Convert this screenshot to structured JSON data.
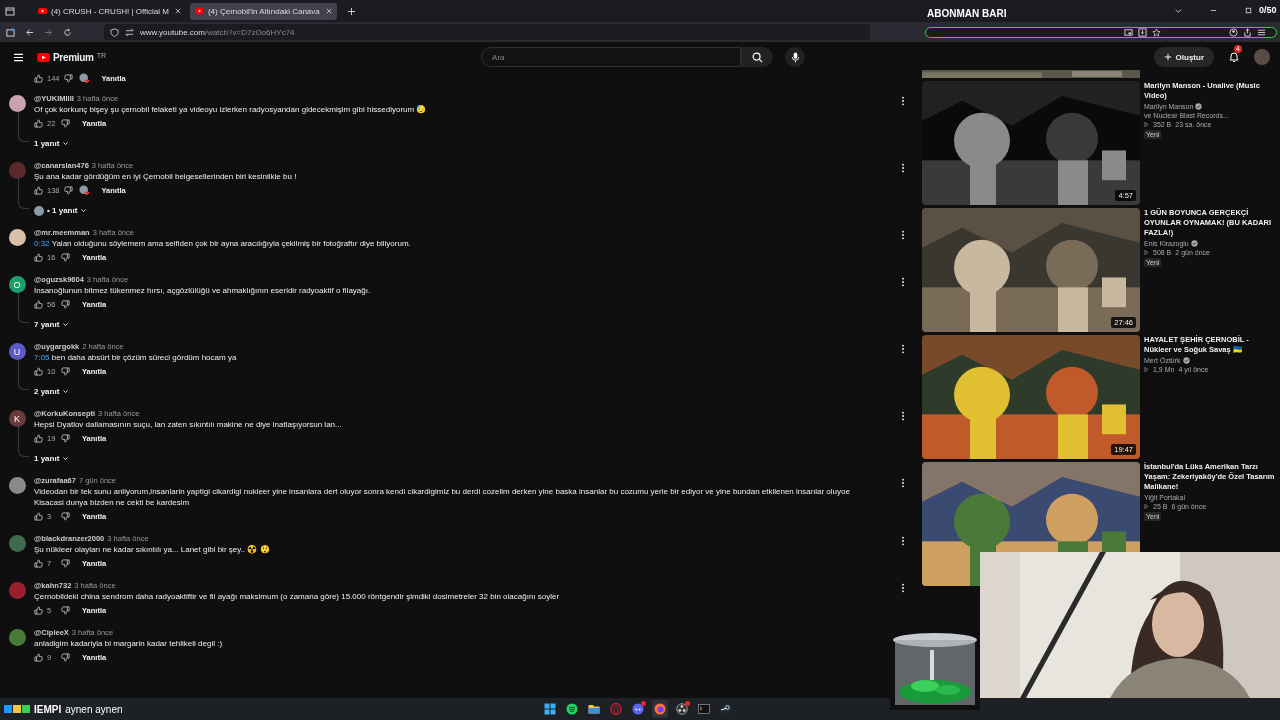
{
  "browser": {
    "tabs": [
      {
        "title": "(4) CRUSH - CRUSH! | Official M",
        "selected": false
      },
      {
        "title": "(4) Çernobil'in Altındaki Canava",
        "selected": true
      }
    ],
    "url_domain": "www.youtube.com",
    "url_path": "/watch?v=D7zOo6HYc74"
  },
  "header": {
    "logo": "Premium",
    "region": "TR",
    "search_placeholder": "Ara",
    "create": "Oluştur",
    "notifications": "4"
  },
  "overlay": {
    "title": "ABONMAN BARI",
    "count": "0/50",
    "level": 0,
    "chat_user": "IEMPI",
    "chat_message": "aynen aynen"
  },
  "top_actions": {
    "likes": "144",
    "reply": "Yanıtla",
    "hearted": true
  },
  "comments": [
    {
      "handle": "@YUKIMIIII",
      "time": "3 hafta önce",
      "text": "Of çok korkunç bişey şu çernobil felaketi ya videoyu izlerken radyosyandan gidecekmişim gibi hissediyorum 😓",
      "likes": "22",
      "hearted": false,
      "reply": "Yanıtla",
      "replies": "1 yanıt",
      "reply_avatar": false
    },
    {
      "handle": "@canarslan476",
      "time": "3 hafta önce",
      "text": "Şu ana kadar gördüğüm en iyi Çernobil belgesellerinden biri kesinlikle bu !",
      "likes": "138",
      "hearted": true,
      "reply": "Yanıtla",
      "replies": "• 1 yanıt",
      "reply_avatar": true
    },
    {
      "handle": "@mr.meemman",
      "time": "3 hafta önce",
      "timestamp": "0:32",
      "text": "Yalan olduğunu söylemem ama selfiden çok bir ayna aracılığıyla çekilmiş bir fotoğraftır diye biliyorum.",
      "likes": "16",
      "hearted": false,
      "reply": "Yanıtla"
    },
    {
      "avatar": {
        "kind": "letter",
        "letter": "O",
        "color": "#1e9e6a"
      },
      "handle": "@oguzsk9604",
      "time": "3 hafta önce",
      "text": "İnsanoğlunun bitmez tükenmez hırsı, açgözlülüğü ve ahmaklığının eseridir radyoaktif o filayağı.",
      "likes": "56",
      "hearted": false,
      "reply": "Yanıtla",
      "replies": "7 yanıt",
      "reply_avatar": false
    },
    {
      "avatar": {
        "kind": "letter",
        "letter": "U",
        "color": "#5c5bc4"
      },
      "handle": "@uygargokk",
      "time": "2 hafta önce",
      "timestamp": "7:05",
      "text": "ben daha absürt bir çözüm süreci gördüm hocam ya",
      "likes": "10",
      "hearted": false,
      "reply": "Yanıtla",
      "replies": "2 yanıt",
      "reply_avatar": false
    },
    {
      "avatar": {
        "kind": "letter",
        "letter": "K",
        "color": "#6b3a3a"
      },
      "handle": "@KorkuKonsepti",
      "time": "3 hafta önce",
      "text": "Hepsi Dyatlov dallamasının suçu, lan zaten sıkıntılı makine ne diye inatlaşıyorsun lan...",
      "likes": "19",
      "hearted": false,
      "reply": "Yanıtla",
      "replies": "1 yanıt",
      "reply_avatar": false
    },
    {
      "handle": "@zurafaa67",
      "time": "7 gün önce",
      "text": "Videodan bir tek sunu anliyorum,insanlarin yaptigi cikardigi nukleer yine insanlara dert oluyor sonra kendi cikardigimiz bu derdi cozelim derken yine baska insanlar bu cozumu yerle bir ediyor ve yine bundan etkilenen insanlar oluyoe Kisacasi dunya bizden ne cekti be kardesim",
      "likes": "3",
      "hearted": false,
      "reply": "Yanıtla"
    },
    {
      "handle": "@blackdranzer2000",
      "time": "3 hafta önce",
      "text": "Şu nükleer olayları ne kadar sıkıntılı ya... Lanet gibi bir şey.. ☢️ 😲",
      "likes": "7",
      "hearted": false,
      "reply": "Yanıtla"
    },
    {
      "handle": "@kahn732",
      "time": "3 hafta önce",
      "text": "Çernobildeki china sendrom daha radyoaktiftir ve fil ayağı maksimum (o zamana göre) 15.000 röntgendir şimdiki dosimetreler 32 bin olacağını soyler",
      "likes": "5",
      "hearted": false,
      "reply": "Yanıtla"
    },
    {
      "handle": "@CipleeX",
      "time": "3 hafta önce",
      "text": "anladigim kadariyla bi margarin kadar tehlikeli degil :)",
      "likes": "9",
      "hearted": false,
      "reply": "Yanıtla"
    }
  ],
  "videos": [
    {
      "title": "Marilyn Manson - Unalive (Music Video)",
      "channel": "Marilyn Manson",
      "verified": true,
      "channel_extra": "ve Nuclear Blast Records...",
      "views": "352 B",
      "age": "23 sa. önce",
      "badge": "Yeni",
      "duration": "4:57"
    },
    {
      "title": "1 GÜN BOYUNCA GERÇEKÇİ OYUNLAR OYNAMAK! (BU KADARI FAZLA!)",
      "channel": "Enis Kirazoglu",
      "verified": true,
      "views": "508 B",
      "age": "2 gün önce",
      "badge": "Yeni",
      "duration": "27:46"
    },
    {
      "title": "HAYALET ŞEHİR ÇERNOBİL - Nükleer ve Soğuk Savaş 🇺🇦",
      "channel": "Mert Öztürk",
      "verified": true,
      "views": "1,9 Mn",
      "age": "4 yıl önce",
      "duration": "19:47"
    },
    {
      "title": "İstanbul'da Lüks Amerikan Tarzı Yaşam: Zekeriyaköy'de Özel Tasarım Malikane!",
      "channel": "Yiğit Portakal",
      "verified": false,
      "views": "25 B",
      "age": "6 gün önce",
      "badge": "Yeni"
    }
  ],
  "taskbar": [
    {
      "kind": "start",
      "active": false,
      "badge": false
    },
    {
      "kind": "spotify",
      "active": false,
      "badge": false
    },
    {
      "kind": "files",
      "active": false,
      "badge": false
    },
    {
      "kind": "opera",
      "active": false,
      "badge": false
    },
    {
      "kind": "discord",
      "active": false,
      "badge": true
    },
    {
      "kind": "firefox",
      "active": true,
      "badge": false
    },
    {
      "kind": "obs",
      "active": false,
      "badge": true
    },
    {
      "kind": "terminal",
      "active": false,
      "badge": false
    },
    {
      "kind": "steam",
      "active": false,
      "badge": false
    }
  ]
}
